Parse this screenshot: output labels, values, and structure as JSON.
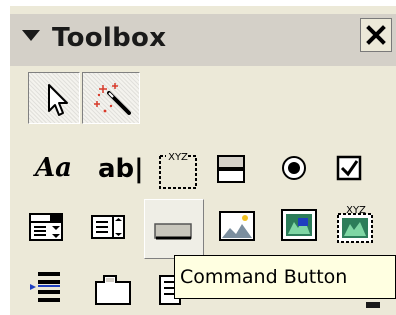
{
  "window": {
    "title": "Toolbox",
    "collapse_icon": "triangle-down-icon",
    "close_icon": "close-x-icon"
  },
  "tools": [
    {
      "id": "select-objects",
      "icon": "pointer-arrow-icon",
      "state": "pressed"
    },
    {
      "id": "magic-wand",
      "icon": "magic-wand-icon"
    },
    {
      "id": "label",
      "icon": "label-aa-icon",
      "text": "Aa"
    },
    {
      "id": "textbox",
      "icon": "textbox-ab-icon",
      "text": "ab|"
    },
    {
      "id": "frame",
      "icon": "frame-icon",
      "text": "XYZ"
    },
    {
      "id": "toggle-button",
      "icon": "toggle-button-icon"
    },
    {
      "id": "option-button",
      "icon": "option-button-icon"
    },
    {
      "id": "check-box",
      "icon": "check-box-icon"
    },
    {
      "id": "combo-box",
      "icon": "combo-box-icon"
    },
    {
      "id": "list-box",
      "icon": "list-box-icon"
    },
    {
      "id": "command-button",
      "icon": "command-button-icon",
      "state": "hover"
    },
    {
      "id": "image",
      "icon": "image-icon"
    },
    {
      "id": "bound-object-frame",
      "icon": "bound-object-frame-icon"
    },
    {
      "id": "unbound-object-frame",
      "icon": "unbound-object-frame-icon",
      "text": "XYZ"
    },
    {
      "id": "page-break",
      "icon": "page-break-icon"
    },
    {
      "id": "tab-control",
      "icon": "tab-control-icon"
    },
    {
      "id": "subform",
      "icon": "subform-icon"
    }
  ],
  "tooltip": {
    "text": "Command Button"
  },
  "colors": {
    "panel": "#ece9d8",
    "titlebar": "#d4d0c8",
    "tooltip_bg": "#ffffe1",
    "accent_blue": "#1f3fbf",
    "accent_green": "#1a7a4a"
  }
}
